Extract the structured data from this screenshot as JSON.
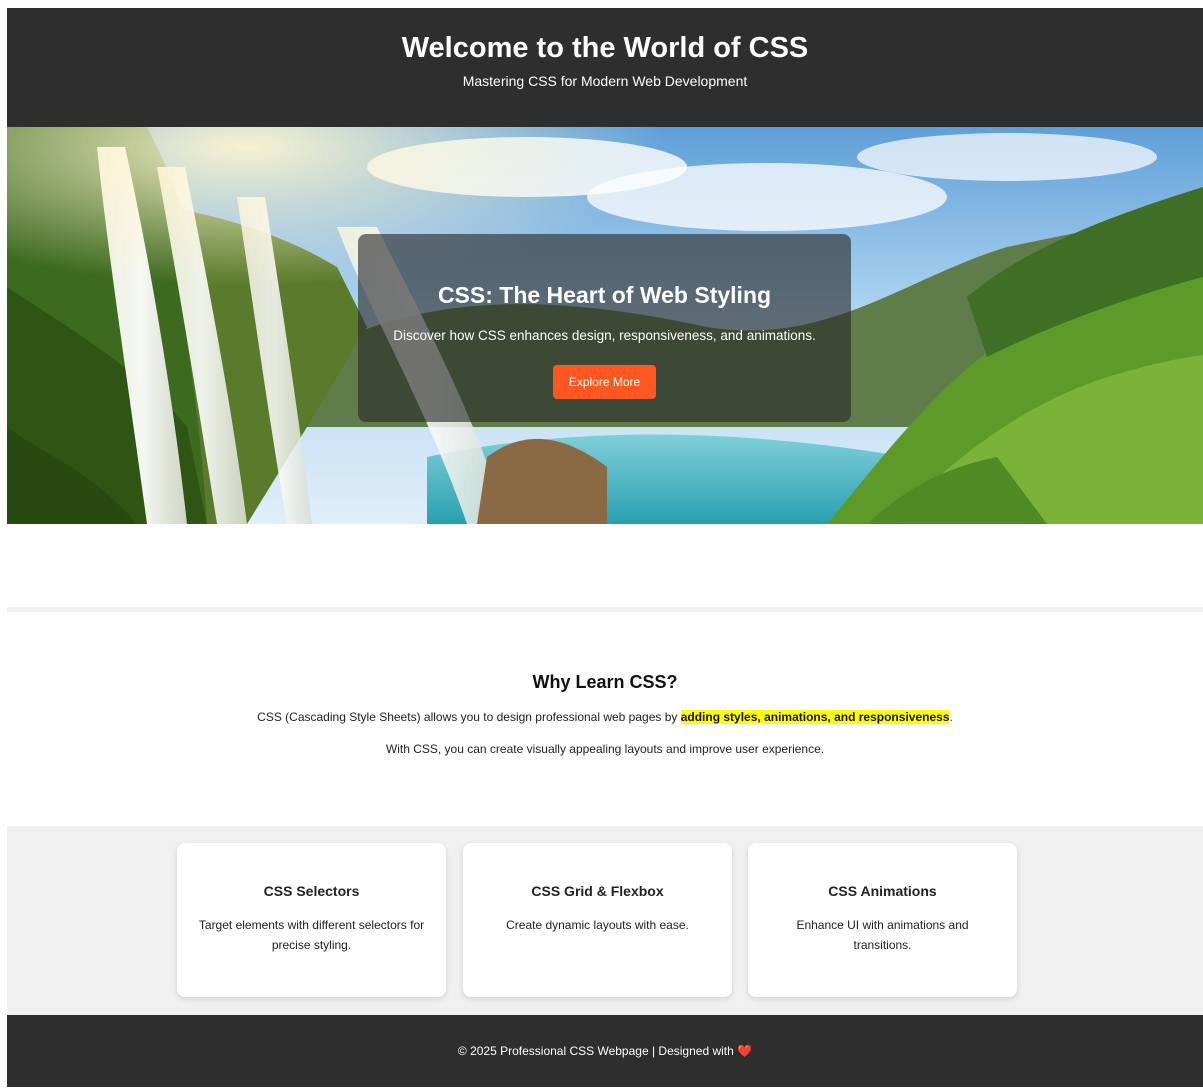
{
  "header": {
    "title": "Welcome to the World of CSS",
    "subtitle": "Mastering CSS for Modern Web Development"
  },
  "hero": {
    "title": "CSS: The Heart of Web Styling",
    "text": "Discover how CSS enhances design, responsiveness, and animations.",
    "button_label": "Explore More",
    "button_color": "#ff5722"
  },
  "why": {
    "title": "Why Learn CSS?",
    "p1_before": "CSS (Cascading Style Sheets) allows you to design professional web pages by ",
    "p1_highlight": "adding styles, animations, and responsiveness",
    "p1_after": ".",
    "p2": "With CSS, you can create visually appealing layouts and improve user experience."
  },
  "features": [
    {
      "title": "CSS Selectors",
      "text": "Target elements with different selectors for precise styling."
    },
    {
      "title": "CSS Grid & Flexbox",
      "text": "Create dynamic layouts with ease."
    },
    {
      "title": "CSS Animations",
      "text": "Enhance UI with animations and transitions."
    }
  ],
  "footer": {
    "text": "© 2025 Professional CSS Webpage | Designed with",
    "heart": "❤️"
  },
  "colors": {
    "dark_bar": "#2e2e2e",
    "accent": "#ff5722",
    "highlight": "#ffff00",
    "features_bg": "#f0f0f0"
  }
}
